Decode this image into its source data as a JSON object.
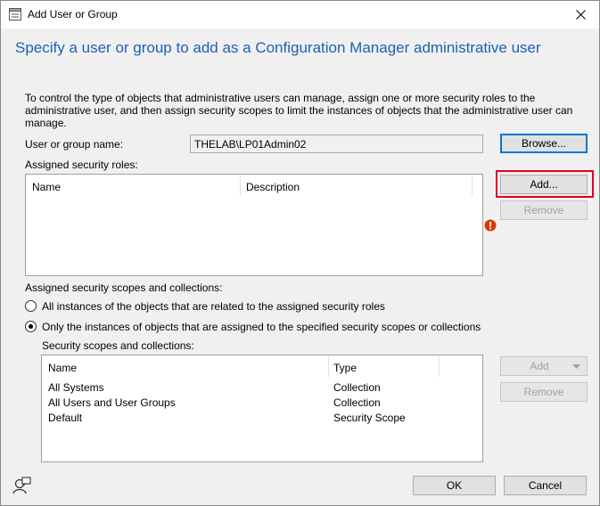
{
  "window": {
    "title": "Add User or Group"
  },
  "heading": "Specify a user or group to add as a Configuration Manager administrative user",
  "description": "To control the type of objects that administrative users can manage, assign one or more security roles  to the  administrative user, and then assign security scopes to limit the instances of objects that the administrative user can manage.",
  "user": {
    "label": "User or group name:",
    "value": "THELAB\\LP01Admin02",
    "browse_label": "Browse..."
  },
  "roles": {
    "label": "Assigned security roles:",
    "columns": [
      "Name",
      "Description"
    ],
    "rows": [],
    "add_label": "Add...",
    "remove_label": "Remove"
  },
  "scopes": {
    "label": "Assigned security scopes and collections:",
    "option_all": "All instances of the objects that are related to the assigned security roles",
    "option_only": "Only the instances of objects that are assigned to the specified security scopes or collections",
    "selected_option": "only",
    "list_label": "Security scopes and collections:",
    "columns": [
      "Name",
      "Type"
    ],
    "rows": [
      {
        "name": "All Systems",
        "type": "Collection"
      },
      {
        "name": "All Users and User Groups",
        "type": "Collection"
      },
      {
        "name": "Default",
        "type": "Security Scope"
      }
    ],
    "add_label": "Add",
    "remove_label": "Remove"
  },
  "footer": {
    "ok_label": "OK",
    "cancel_label": "Cancel"
  },
  "colors": {
    "heading": "#1f5fb4",
    "highlight": "#e0001b",
    "error": "#d83b01"
  },
  "icons": [
    "dialog-icon",
    "close-icon",
    "error-icon",
    "dropdown-arrow-icon",
    "user-help-icon"
  ]
}
